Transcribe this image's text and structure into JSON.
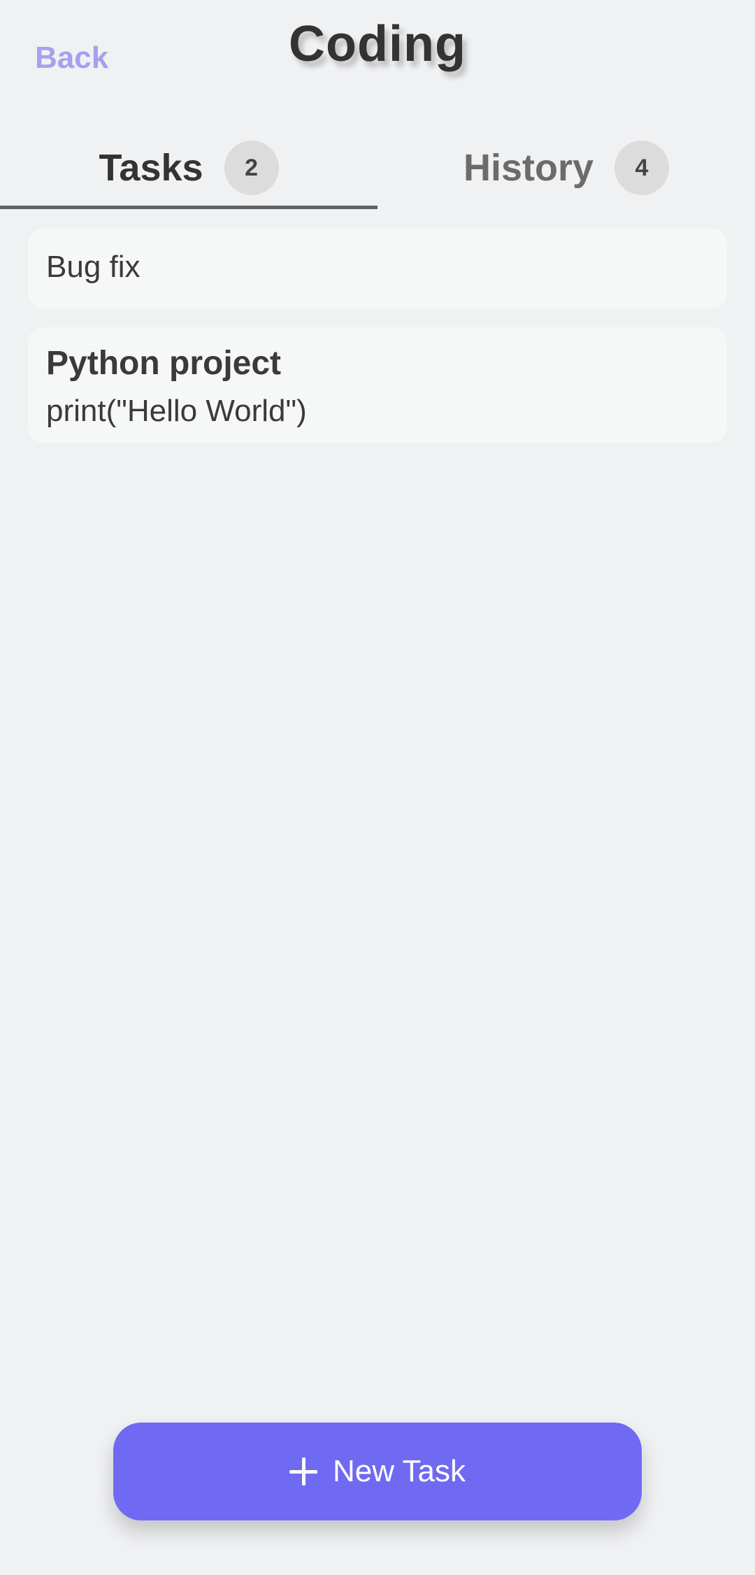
{
  "header": {
    "back_label": "Back",
    "title": "Coding"
  },
  "tabs": [
    {
      "label": "Tasks",
      "count": "2",
      "active": true
    },
    {
      "label": "History",
      "count": "4",
      "active": false
    }
  ],
  "tasks": [
    {
      "text": "Bug fix"
    },
    {
      "title": "Python project",
      "description": "print(\"Hello World\")"
    }
  ],
  "new_task_button": {
    "label": "New Task",
    "icon": "plus-icon"
  },
  "colors": {
    "background": "#f0f1f3",
    "accent": "#6f6af1",
    "back_link": "#a6a0ee",
    "card": "#f6f7f7"
  }
}
